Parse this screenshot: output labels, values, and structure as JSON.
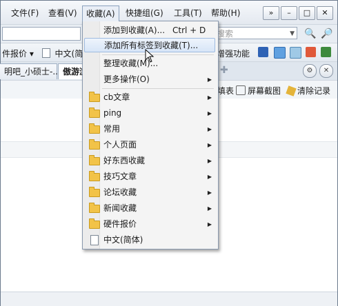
{
  "menubar": {
    "items": [
      {
        "label": "文件(F)"
      },
      {
        "label": "查看(V)"
      },
      {
        "label": "收藏(A)"
      },
      {
        "label": "快捷组(G)"
      },
      {
        "label": "工具(T)"
      },
      {
        "label": "帮助(H)"
      }
    ],
    "window_buttons": {
      "collapse": "»",
      "minimize": "–",
      "maximize": "□",
      "close": "✕"
    }
  },
  "search": {
    "placeholder": "搜索"
  },
  "toolbar": {
    "left_text": "件报价",
    "left_dropdown": "▾",
    "doc_label": "中文(简体",
    "right_text": "增强功能"
  },
  "tabs": [
    {
      "label": "明吧_小硕士-..."
    },
    {
      "label": "傲游浏"
    }
  ],
  "actions": [
    {
      "label": "填表"
    },
    {
      "label": "屏幕截图"
    },
    {
      "label": "清除记录"
    }
  ],
  "dropdown": {
    "items": [
      {
        "label": "添加到收藏(A)...",
        "accel": "Ctrl + D"
      },
      {
        "label": "添加所有标签到收藏(T)..."
      },
      {
        "label": "整理收藏(M)..."
      },
      {
        "label": "更多操作(O)"
      },
      {
        "label": "cb文章"
      },
      {
        "label": "ping"
      },
      {
        "label": "常用"
      },
      {
        "label": "个人页面"
      },
      {
        "label": "好东西收藏"
      },
      {
        "label": "技巧文章"
      },
      {
        "label": "论坛收藏"
      },
      {
        "label": "新闻收藏"
      },
      {
        "label": "硬件报价"
      },
      {
        "label": "中文(简体)"
      }
    ],
    "submenu_arrow": "▶"
  },
  "colors": {
    "menu_highlight": "#d7e5f7",
    "folder": "#f2c348",
    "accent": "#3a6aa8"
  }
}
